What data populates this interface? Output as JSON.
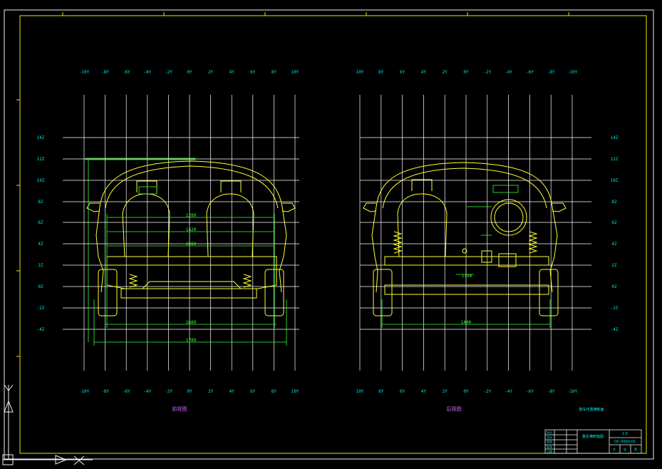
{
  "colors": {
    "background": "#000000",
    "border": "#f0f0f0",
    "frame": "#e6e600",
    "grid": "#ffffff",
    "label": "#00e5e5",
    "body_outline": "#ffff33",
    "dimension": "#33ff33",
    "title_text": "#cc66ff"
  },
  "icons": {
    "ucs": "ucs-y-axis-icon",
    "crosshair": "crosshair-icon"
  },
  "ucs": {
    "y_label": "Y",
    "x_label": "X"
  },
  "views": [
    {
      "id": "left",
      "title": "前视图",
      "top_labels": [
        "-10Y",
        "-8Y",
        "-6Y",
        "-4Y",
        "-2Y",
        "0Y",
        "2Y",
        "4Y",
        "6Y",
        "8Y",
        "10Y"
      ],
      "bottom_labels": [
        "-10Y",
        "-8Y",
        "-6Y",
        "-4Y",
        "-2Y",
        "0Y",
        "2Y",
        "4Y",
        "6Y",
        "8Y",
        "10Y"
      ],
      "z_labels": [
        "14Z",
        "12Z",
        "10Z",
        "8Z",
        "6Z",
        "4Z",
        "2Z",
        "0Z",
        "-2Z",
        "-4Z"
      ],
      "dimensions": [
        "1280",
        "1420",
        "1560",
        "1680",
        "1780"
      ]
    },
    {
      "id": "right",
      "title": "后视图",
      "top_labels": [
        "10Y",
        "8Y",
        "6Y",
        "4Y",
        "2Y",
        "0Y",
        "-2Y",
        "-4Y",
        "-6Y",
        "-8Y",
        "-10Y"
      ],
      "bottom_labels": [
        "10Y",
        "8Y",
        "6Y",
        "4Y",
        "2Y",
        "0Y",
        "-2Y",
        "-4Y",
        "-6Y",
        "-8Y",
        "-10Y"
      ],
      "z_labels": [
        "14Z",
        "12Z",
        "10Z",
        "8Z",
        "6Z",
        "4Z",
        "2Z",
        "0Z",
        "-2Z",
        "-4Z"
      ],
      "dimensions": [
        "1190",
        "1440"
      ],
      "note": "整车布置横断面"
    }
  ],
  "title_block": {
    "name": "整车横断面图",
    "scale": "1:5",
    "drawing_no": "QC-0000-01",
    "rows": [
      "标记",
      "设计",
      "审核",
      "批准",
      "日期"
    ],
    "cells": [
      "共",
      "张",
      "第"
    ]
  }
}
